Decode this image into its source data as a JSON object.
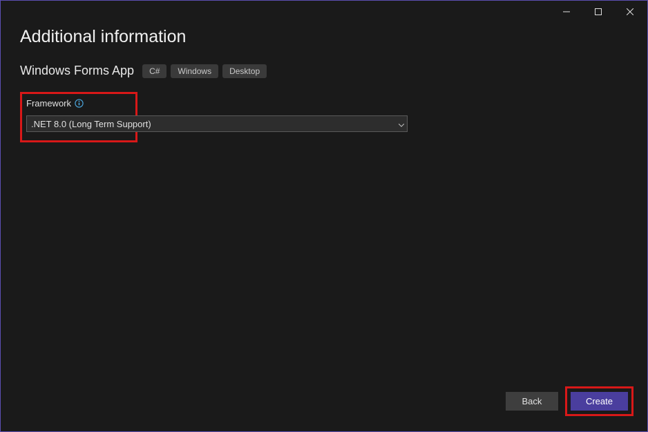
{
  "window": {
    "minimize": "Minimize",
    "maximize": "Maximize",
    "close": "Close"
  },
  "page": {
    "title": "Additional information",
    "subtitle": "Windows Forms App",
    "tags": [
      "C#",
      "Windows",
      "Desktop"
    ]
  },
  "framework": {
    "label": "Framework",
    "selected": ".NET 8.0 (Long Term Support)"
  },
  "buttons": {
    "back": "Back",
    "create": "Create"
  }
}
